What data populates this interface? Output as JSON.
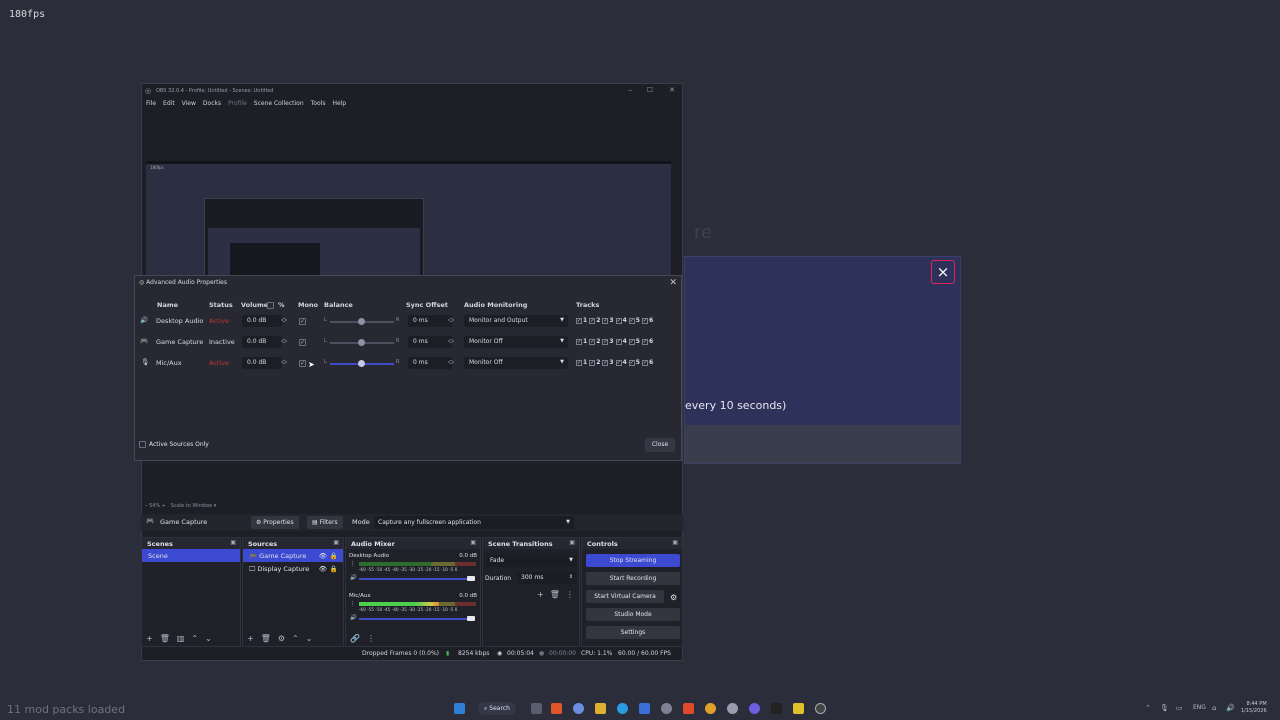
{
  "overlay_fps": "180fps",
  "mods_loaded": "11 mod packs loaded",
  "bg_dialog": {
    "close": "×",
    "text": "every 10 seconds)",
    "faint_text": "re"
  },
  "obs": {
    "title": "OBS 32.0.4 - Profile: Untitled - Scenes: Untitled",
    "menu": [
      "File",
      "Edit",
      "View",
      "Docks",
      "Profile",
      "Scene Collection",
      "Tools",
      "Help"
    ],
    "preview_fps": "180fps"
  },
  "aap": {
    "title": "Advanced Audio Properties",
    "headers": {
      "name": "Name",
      "status": "Status",
      "volume": "Volume",
      "percent": "%",
      "mono": "Mono",
      "balance": "Balance",
      "sync": "Sync Offset",
      "monitoring": "Audio Monitoring",
      "tracks": "Tracks"
    },
    "balance_l": "L",
    "balance_r": "R",
    "rows": [
      {
        "name": "Desktop Audio",
        "status": "Active",
        "status_color": "#c0392b",
        "volume": "0.0 dB",
        "sync": "0 ms",
        "monitoring": "Monitor and Output"
      },
      {
        "name": "Game Capture",
        "status": "Inactive",
        "status_color": "#d8dae4",
        "volume": "0.0 dB",
        "sync": "0 ms",
        "monitoring": "Monitor Off"
      },
      {
        "name": "Mic/Aux",
        "status": "Active",
        "status_color": "#c0392b",
        "volume": "0.0 dB",
        "sync": "0 ms",
        "monitoring": "Monitor Off"
      }
    ],
    "track_numbers": [
      "1",
      "2",
      "3",
      "4",
      "5",
      "6"
    ],
    "active_only": "Active Sources Only",
    "close": "Close"
  },
  "scale_bar": {
    "zoom": "54%",
    "mode": "Scale to Window"
  },
  "source_bar": {
    "source": "Game Capture",
    "properties": "Properties",
    "filters": "Filters",
    "mode_label": "Mode",
    "mode_value": "Capture any fullscreen application"
  },
  "docks": {
    "scenes": {
      "title": "Scenes",
      "items": [
        "Scene"
      ]
    },
    "sources": {
      "title": "Sources",
      "items": [
        "Game Capture",
        "Display Capture"
      ]
    },
    "mixer": {
      "title": "Audio Mixer",
      "channels": [
        {
          "name": "Desktop Audio",
          "db": "0.0 dB",
          "level_pct": 0
        },
        {
          "name": "Mic/Aux",
          "db": "0.0 dB",
          "level_pct": 68
        }
      ],
      "scale": "-60 -55 -50 -45 -40 -35 -30 -25 -20 -15 -10 -5 0"
    },
    "transitions": {
      "title": "Scene Transitions",
      "type": "Fade",
      "duration_label": "Duration",
      "duration_value": "300 ms"
    },
    "controls": {
      "title": "Controls",
      "buttons": [
        "Stop Streaming",
        "Start Recording",
        "Start Virtual Camera",
        "Studio Mode",
        "Settings"
      ]
    }
  },
  "status_bar": {
    "dropped": "Dropped Frames 0 (0.0%)",
    "kbps": "8254 kbps",
    "stream_time": "00:05:04",
    "rec_time": "00:00:00",
    "cpu": "CPU: 1.1%",
    "fps": "60.00 / 60.00 FPS"
  },
  "taskbar": {
    "search": "Search",
    "lang": "ENG",
    "time": "8:44 PM",
    "date": "1/15/2026"
  }
}
